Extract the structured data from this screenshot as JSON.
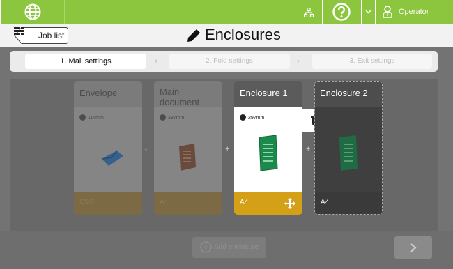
{
  "topbar": {
    "operator_label": "Operator",
    "colors": {
      "bar": "#8cc63f"
    },
    "icons": [
      "globe-icon",
      "network-icon",
      "help-icon",
      "chevron-down-icon",
      "operator-icon"
    ]
  },
  "header": {
    "back_label": "Job list",
    "title": "Enclosures"
  },
  "steps": [
    {
      "label": "1. Mail settings"
    },
    {
      "label": "2. Fold settings"
    },
    {
      "label": "3. Exit settings"
    }
  ],
  "cards": [
    {
      "title": "Envelope",
      "info": "114mm",
      "footer": "C5/6"
    },
    {
      "title": "Main document",
      "info": "297mm",
      "footer": "A4"
    },
    {
      "title": "Enclosure 1",
      "info": "297mm",
      "footer": "A4"
    },
    {
      "title": "Enclosure 2",
      "footer": "A4"
    }
  ],
  "add_button_label": "Add enclosure",
  "colors": {
    "accent": "#d4a017",
    "green": "#8cc63f"
  }
}
